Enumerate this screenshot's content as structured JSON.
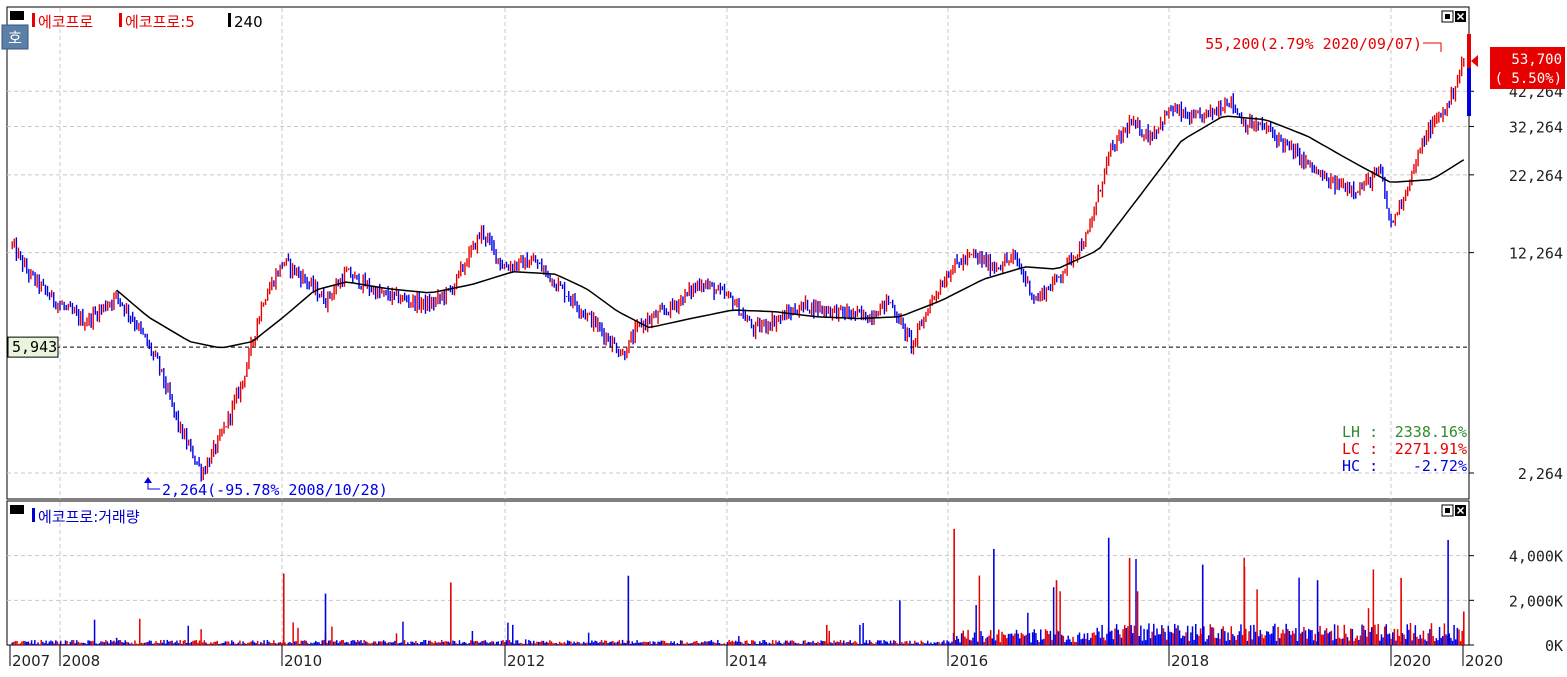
{
  "legend": {
    "main": [
      {
        "label": "에코프로",
        "color": "#e60000"
      },
      {
        "label": "에코프로:5",
        "color": "#e60000"
      },
      {
        "label": "240",
        "color": "#000000"
      }
    ],
    "volume": [
      {
        "label": "에코프로:거래량",
        "color": "#0000cc"
      }
    ]
  },
  "side_tab": {
    "label": "호"
  },
  "colors": {
    "up": "#e60000",
    "down": "#0000e6",
    "ma": "#000000",
    "grid": "#c8c8c8",
    "green": "#2e8b2e",
    "red": "#e60000",
    "blue": "#0000e6"
  },
  "icons": {
    "panel": "panel-square-icon",
    "restore": "restore-window-icon",
    "close": "close-x-icon"
  },
  "price_box": {
    "value": "53,700",
    "change": "( 5.50%)"
  },
  "annotations": {
    "high": "55,200(2.79% 2020/09/07)",
    "low": "2,264(-95.78% 2008/10/28)",
    "ref_line": "5,943"
  },
  "stats": [
    {
      "label": "LH :",
      "value": "2338.16%",
      "color": "#2e8b2e"
    },
    {
      "label": "LC :",
      "value": "2271.91%",
      "color": "#e60000"
    },
    {
      "label": "HC :",
      "value": "-2.72%",
      "color": "#0000e6"
    }
  ],
  "chart_data": [
    {
      "type": "line",
      "scale": "log",
      "y_ticks": [
        42264,
        32264,
        22264,
        12264,
        2264
      ],
      "y_tick_labels": [
        "42,264",
        "32,264",
        "22,264",
        "12,264",
        "2,264"
      ],
      "reference_line": 5943,
      "x_tick_labels": [
        "2007",
        "2008",
        "2010",
        "2012",
        "2014",
        "2016",
        "2018",
        "2020",
        "2020"
      ],
      "series": [
        {
          "values": [
            [
              2007.0,
              13000
            ],
            [
              2007.15,
              10500
            ],
            [
              2007.4,
              8500
            ],
            [
              2007.7,
              7200
            ],
            [
              2008.0,
              8800
            ],
            [
              2008.2,
              7000
            ],
            [
              2008.4,
              5200
            ],
            [
              2008.6,
              3200
            ],
            [
              2008.82,
              2264
            ],
            [
              2009.0,
              3000
            ],
            [
              2009.2,
              4500
            ],
            [
              2009.4,
              8500
            ],
            [
              2009.6,
              11500
            ],
            [
              2009.8,
              10000
            ],
            [
              2010.0,
              8500
            ],
            [
              2010.2,
              10500
            ],
            [
              2010.5,
              9000
            ],
            [
              2010.8,
              8500
            ],
            [
              2011.0,
              8200
            ],
            [
              2011.2,
              9200
            ],
            [
              2011.5,
              14500
            ],
            [
              2011.7,
              11000
            ],
            [
              2012.0,
              11500
            ],
            [
              2012.3,
              9000
            ],
            [
              2012.6,
              7000
            ],
            [
              2012.85,
              5600
            ],
            [
              2013.0,
              7000
            ],
            [
              2013.3,
              8000
            ],
            [
              2013.6,
              9800
            ],
            [
              2013.9,
              8500
            ],
            [
              2014.1,
              6800
            ],
            [
              2014.3,
              7300
            ],
            [
              2014.6,
              8200
            ],
            [
              2014.9,
              7800
            ],
            [
              2015.2,
              7500
            ],
            [
              2015.4,
              8500
            ],
            [
              2015.62,
              6000
            ],
            [
              2015.8,
              8500
            ],
            [
              2016.0,
              11000
            ],
            [
              2016.2,
              12000
            ],
            [
              2016.4,
              11000
            ],
            [
              2016.6,
              11800
            ],
            [
              2016.8,
              8500
            ],
            [
              2017.0,
              10000
            ],
            [
              2017.3,
              14000
            ],
            [
              2017.5,
              26000
            ],
            [
              2017.7,
              33000
            ],
            [
              2017.9,
              30000
            ],
            [
              2018.1,
              37000
            ],
            [
              2018.3,
              34000
            ],
            [
              2018.5,
              36000
            ],
            [
              2018.65,
              40000
            ],
            [
              2018.8,
              33000
            ],
            [
              2019.0,
              32000
            ],
            [
              2019.3,
              26000
            ],
            [
              2019.6,
              21000
            ],
            [
              2019.9,
              20000
            ],
            [
              2020.1,
              23000
            ],
            [
              2020.2,
              15000
            ],
            [
              2020.35,
              20000
            ],
            [
              2020.55,
              31000
            ],
            [
              2020.75,
              38000
            ],
            [
              2020.9,
              53700
            ]
          ]
        },
        {
          "values": [
            [
              2008.0,
              9200
            ],
            [
              2008.3,
              7500
            ],
            [
              2008.7,
              6200
            ],
            [
              2009.0,
              5900
            ],
            [
              2009.3,
              6200
            ],
            [
              2009.6,
              7500
            ],
            [
              2009.9,
              9200
            ],
            [
              2010.2,
              9800
            ],
            [
              2010.6,
              9300
            ],
            [
              2011.0,
              9000
            ],
            [
              2011.4,
              9600
            ],
            [
              2011.8,
              10600
            ],
            [
              2012.2,
              10400
            ],
            [
              2012.5,
              9300
            ],
            [
              2012.8,
              7800
            ],
            [
              2013.1,
              6900
            ],
            [
              2013.5,
              7400
            ],
            [
              2013.9,
              7900
            ],
            [
              2014.3,
              7800
            ],
            [
              2014.7,
              7500
            ],
            [
              2015.1,
              7400
            ],
            [
              2015.5,
              7500
            ],
            [
              2015.9,
              8500
            ],
            [
              2016.3,
              10000
            ],
            [
              2016.7,
              11000
            ],
            [
              2017.0,
              10800
            ],
            [
              2017.4,
              12500
            ],
            [
              2017.8,
              19000
            ],
            [
              2018.2,
              29000
            ],
            [
              2018.6,
              35000
            ],
            [
              2019.0,
              34000
            ],
            [
              2019.4,
              30000
            ],
            [
              2019.8,
              25000
            ],
            [
              2020.2,
              21000
            ],
            [
              2020.6,
              21500
            ],
            [
              2020.9,
              25000
            ]
          ]
        }
      ]
    },
    {
      "type": "bar",
      "y_ticks": [
        4000,
        2000,
        0
      ],
      "y_tick_labels": [
        "4,000K",
        "2,000K",
        "0K"
      ],
      "y_unit": "K",
      "peaks": [
        [
          2008.0,
          320
        ],
        [
          2009.6,
          3200
        ],
        [
          2010.0,
          2300
        ],
        [
          2011.2,
          2800
        ],
        [
          2012.9,
          3100
        ],
        [
          2014.8,
          900
        ],
        [
          2015.5,
          2000
        ],
        [
          2016.02,
          5200
        ],
        [
          2016.4,
          4300
        ],
        [
          2017.0,
          2900
        ],
        [
          2017.5,
          4800
        ],
        [
          2017.7,
          3900
        ],
        [
          2018.4,
          3600
        ],
        [
          2018.8,
          3500
        ],
        [
          2019.5,
          2900
        ],
        [
          2020.3,
          3000
        ],
        [
          2020.75,
          4700
        ],
        [
          2020.9,
          1500
        ]
      ]
    }
  ]
}
